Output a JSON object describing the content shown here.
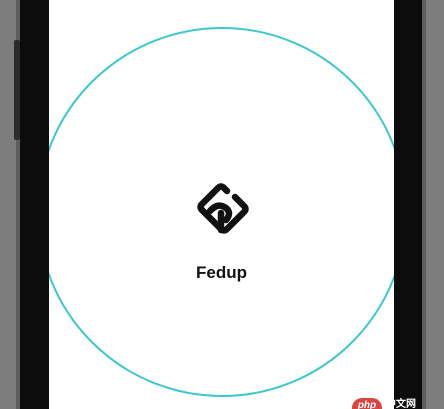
{
  "app": {
    "name": "Fedup",
    "logo_icon": "fedup-logo-icon"
  },
  "colors": {
    "circle_stroke": "#3cc8cc",
    "screen_background": "#ffffff",
    "text": "#111111",
    "bezel": "#0c0c0c"
  },
  "watermark": {
    "badge": "php",
    "text": "中文网"
  }
}
